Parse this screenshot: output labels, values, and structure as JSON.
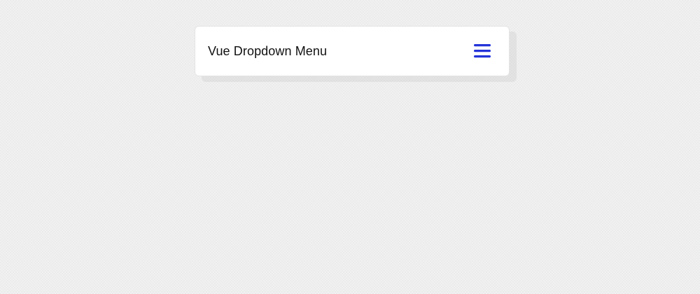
{
  "header": {
    "title": "Vue Dropdown Menu"
  },
  "toggle": {
    "icon": "hamburger-menu-icon",
    "color": "#2433d9"
  },
  "colors": {
    "background": "#f1f1f1",
    "card": "#ffffff",
    "text": "#111111",
    "accent": "#2433d9"
  }
}
